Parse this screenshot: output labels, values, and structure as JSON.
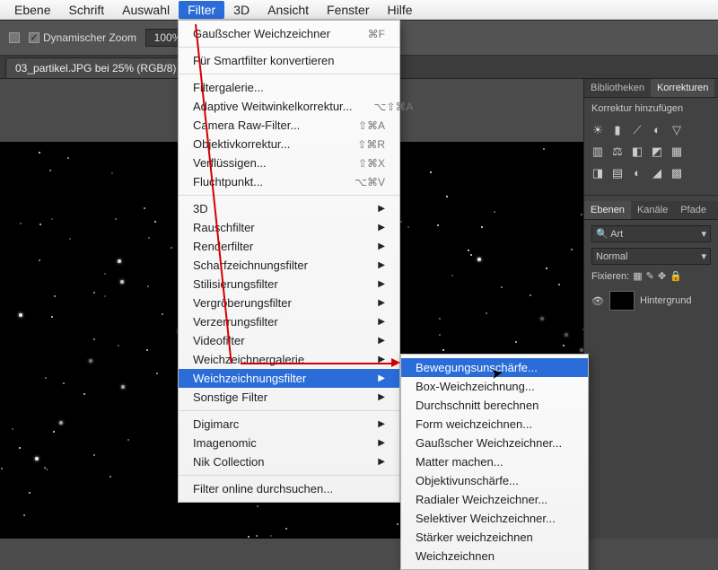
{
  "menubar": {
    "items": [
      "Ebene",
      "Schrift",
      "Auswahl",
      "Filter",
      "3D",
      "Ansicht",
      "Fenster",
      "Hilfe"
    ],
    "activeIndex": 3
  },
  "optionsbar": {
    "dynamischerZoom": "Dynamischer Zoom",
    "zoomValue": "100%"
  },
  "tab": {
    "title": "03_partikel.JPG bei 25% (RGB/8)"
  },
  "rightPanels": {
    "top": {
      "tabs": [
        "Bibliotheken",
        "Korrekturen"
      ],
      "activeIndex": 1,
      "subtitle": "Korrektur hinzufügen"
    },
    "layers": {
      "tabs": [
        "Ebenen",
        "Kanäle",
        "Pfade"
      ],
      "activeIndex": 0,
      "kindSearch": "Art",
      "blendMode": "Normal",
      "lockLabel": "Fixieren:",
      "layerName": "Hintergrund"
    }
  },
  "filterMenu": {
    "top": [
      {
        "label": "Gaußscher Weichzeichner",
        "shortcut": "⌘F"
      }
    ],
    "group1": [
      {
        "label": "Für Smartfilter konvertieren"
      }
    ],
    "group2": [
      {
        "label": "Filtergalerie..."
      },
      {
        "label": "Adaptive Weitwinkelkorrektur...",
        "shortcut": "⌥⇧⌘A"
      },
      {
        "label": "Camera Raw-Filter...",
        "shortcut": "⇧⌘A"
      },
      {
        "label": "Objektivkorrektur...",
        "shortcut": "⇧⌘R"
      },
      {
        "label": "Verflüssigen...",
        "shortcut": "⇧⌘X"
      },
      {
        "label": "Fluchtpunkt...",
        "shortcut": "⌥⌘V"
      }
    ],
    "group3": [
      {
        "label": "3D",
        "submenu": true
      },
      {
        "label": "Rauschfilter",
        "submenu": true
      },
      {
        "label": "Renderfilter",
        "submenu": true
      },
      {
        "label": "Scharfzeichnungsfilter",
        "submenu": true
      },
      {
        "label": "Stilisierungsfilter",
        "submenu": true
      },
      {
        "label": "Vergröberungsfilter",
        "submenu": true
      },
      {
        "label": "Verzerrungsfilter",
        "submenu": true
      },
      {
        "label": "Videofilter",
        "submenu": true
      },
      {
        "label": "Weichzeichnergalerie",
        "submenu": true
      },
      {
        "label": "Weichzeichnungsfilter",
        "submenu": true,
        "highlight": true
      },
      {
        "label": "Sonstige Filter",
        "submenu": true
      }
    ],
    "group4": [
      {
        "label": "Digimarc",
        "submenu": true
      },
      {
        "label": "Imagenomic",
        "submenu": true
      },
      {
        "label": "Nik Collection",
        "submenu": true
      }
    ],
    "group5": [
      {
        "label": "Filter online durchsuchen..."
      }
    ]
  },
  "blurSubmenu": {
    "items": [
      {
        "label": "Bewegungsunschärfe...",
        "highlight": true
      },
      {
        "label": "Box-Weichzeichnung..."
      },
      {
        "label": "Durchschnitt berechnen"
      },
      {
        "label": "Form weichzeichnen..."
      },
      {
        "label": "Gaußscher Weichzeichner..."
      },
      {
        "label": "Matter machen..."
      },
      {
        "label": "Objektivunschärfe..."
      },
      {
        "label": "Radialer Weichzeichner..."
      },
      {
        "label": "Selektiver Weichzeichner..."
      },
      {
        "label": "Stärker weichzeichnen"
      },
      {
        "label": "Weichzeichnen"
      }
    ]
  }
}
